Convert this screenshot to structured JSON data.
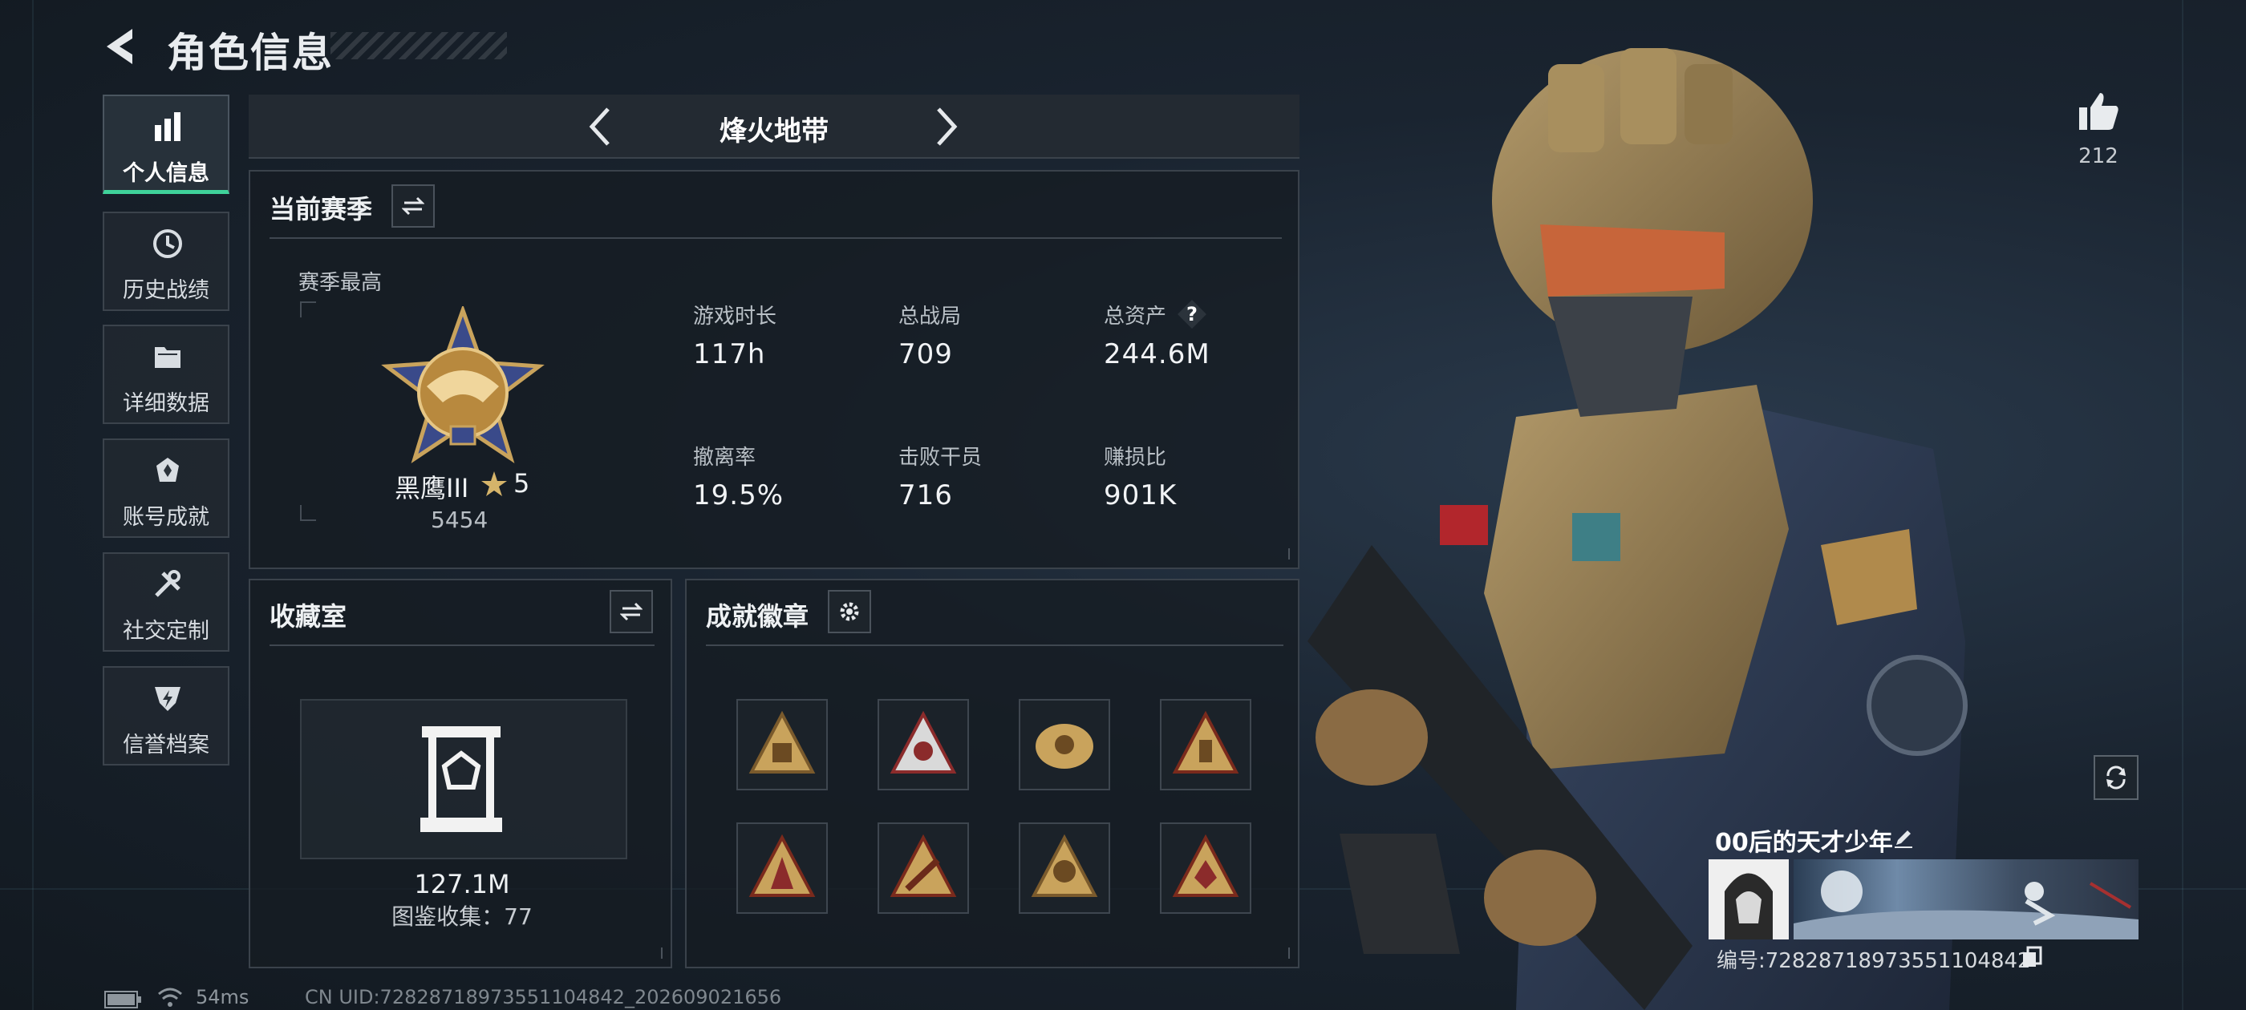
{
  "header": {
    "title": "角色信息"
  },
  "sidebar": {
    "items": [
      {
        "label": "个人信息",
        "icon": "bar-chart-icon",
        "active": true
      },
      {
        "label": "历史战绩",
        "icon": "history-clock-icon"
      },
      {
        "label": "详细数据",
        "icon": "folder-icon"
      },
      {
        "label": "账号成就",
        "icon": "achievement-icon"
      },
      {
        "label": "社交定制",
        "icon": "tools-icon"
      },
      {
        "label": "信誉档案",
        "icon": "shield-bolt-icon"
      }
    ]
  },
  "mode": {
    "title": "烽火地带"
  },
  "season": {
    "title": "当前赛季",
    "best_label": "赛季最高",
    "rank_name": "黑鹰III",
    "rank_stars": "5",
    "rank_score": "5454",
    "stats": [
      {
        "label": "游戏时长",
        "value": "117h"
      },
      {
        "label": "总战局",
        "value": "709"
      },
      {
        "label": "总资产",
        "value": "244.6M",
        "help": "?"
      },
      {
        "label": "撤离率",
        "value": "19.5%"
      },
      {
        "label": "击败干员",
        "value": "716"
      },
      {
        "label": "赚损比",
        "value": "901K"
      }
    ]
  },
  "collection": {
    "title": "收藏室",
    "value": "127.1M",
    "codex_line": "图鉴收集：77"
  },
  "achievements": {
    "title": "成就徽章",
    "badge_count": 8
  },
  "profile": {
    "likes": "212",
    "nickname": "00后的天才少年",
    "id_line": "编号:7282871897355110484​2"
  },
  "footer": {
    "ping": "54ms",
    "cn_uid": "CN UID:7282871897355110484​2_202609021656"
  },
  "colors": {
    "accent": "#3fd29a",
    "gold": "#c9a35c",
    "panel_border": "#3a424b"
  }
}
